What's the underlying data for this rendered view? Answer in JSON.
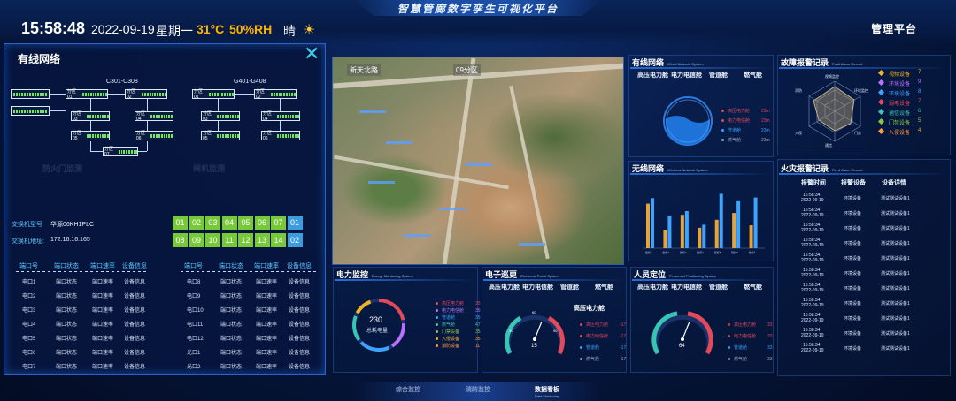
{
  "header": {
    "system_title": "智慧管廊数字孪生可视化平台",
    "time": "15:58:48",
    "date": "2022-09-19",
    "weekday": "星期一",
    "temperature": "31°C",
    "humidity": "50%RH",
    "weather": "晴",
    "weather_icon": "sun-icon",
    "management_label": "管理平台"
  },
  "overlay": {
    "title": "有线网络",
    "close_icon": "close-icon",
    "group_left": "C301-C308",
    "group_right": "G401-G408",
    "switches_left": [
      "分区01",
      "分区02",
      "分区03",
      "分区04",
      "分区05",
      "分区06",
      "分区07"
    ],
    "switches_right": [
      "分区01",
      "分区02",
      "分区03",
      "分区04",
      "分区05",
      "分区06"
    ],
    "switch_model_label": "交换机型号",
    "switch_model_value": "华源06KH1PLC",
    "switch_addr_label": "交换机地址:",
    "switch_addr_value": "172.16.16.165",
    "ports": [
      "01",
      "02",
      "03",
      "04",
      "05",
      "06",
      "07",
      "01",
      "08",
      "09",
      "10",
      "11",
      "12",
      "13",
      "14",
      "02"
    ],
    "port_colors": {
      "online": "#78c93a",
      "uplink": "#3b9de0"
    },
    "table_headers": [
      "端口号",
      "端口状态",
      "端口速率",
      "设备信息"
    ],
    "left_rows": [
      [
        "电口1",
        "端口状态",
        "端口速率",
        "设备信息"
      ],
      [
        "电口2",
        "端口状态",
        "端口速率",
        "设备信息"
      ],
      [
        "电口3",
        "端口状态",
        "端口速率",
        "设备信息"
      ],
      [
        "电口4",
        "端口状态",
        "端口速率",
        "设备信息"
      ],
      [
        "电口5",
        "端口状态",
        "端口速率",
        "设备信息"
      ],
      [
        "电口6",
        "端口状态",
        "端口速率",
        "设备信息"
      ],
      [
        "电口7",
        "端口状态",
        "端口速率",
        "设备信息"
      ]
    ],
    "right_rows": [
      [
        "电口8",
        "端口状态",
        "端口速率",
        "设备信息"
      ],
      [
        "电口9",
        "端口状态",
        "端口速率",
        "设备信息"
      ],
      [
        "电口10",
        "端口状态",
        "端口速率",
        "设备信息"
      ],
      [
        "电口11",
        "端口状态",
        "端口速率",
        "设备信息"
      ],
      [
        "电口12",
        "端口状态",
        "端口速率",
        "设备信息"
      ],
      [
        "光口1",
        "端口状态",
        "端口速率",
        "设备信息"
      ],
      [
        "光口2",
        "端口状态",
        "端口速率",
        "设备信息"
      ]
    ],
    "ghost_labels": [
      "防火门监测",
      "闸机监测"
    ]
  },
  "map": {
    "road_label": "新天北路",
    "area_label": "09分区"
  },
  "wired": {
    "title": "有线网络",
    "subtitle": "Wired Network System",
    "columns": [
      "高压电力舱",
      "电力电信舱",
      "管道舱",
      "燃气舱"
    ],
    "legend": [
      {
        "name": "高压电力舱",
        "value": "23m",
        "color": "#e2495b"
      },
      {
        "name": "电力电信舱",
        "value": "23m",
        "color": "#e2495b"
      },
      {
        "name": "管道舱",
        "value": "23m",
        "color": "#3ea3ff"
      },
      {
        "name": "燃气舱",
        "value": "23m",
        "color": "#9aa4b8"
      }
    ]
  },
  "wireless": {
    "title": "无线网络",
    "subtitle": "Wireless Network System",
    "chart_data": {
      "type": "bar",
      "categories": [
        "指标1",
        "指标2",
        "指标3",
        "指标4",
        "指标5",
        "指标6",
        "指标7"
      ],
      "series": [
        {
          "values": [
            72,
            30,
            54,
            33,
            46,
            57,
            37
          ],
          "color": "#e7a23a"
        },
        {
          "values": [
            81,
            53,
            60,
            38,
            88,
            76,
            82
          ],
          "color": "#3ea3ff"
        }
      ],
      "ylim": [
        0,
        100
      ]
    }
  },
  "fault": {
    "title": "故障报警记录",
    "subtitle": "Fault Alarm Record",
    "radar_labels": [
      "视频监控",
      "环境监控",
      "门禁",
      "通信",
      "入侵",
      "消防"
    ],
    "legend": [
      {
        "name": "视频设备",
        "value": "7",
        "color": "#f0b429"
      },
      {
        "name": "环境设备",
        "value": "9",
        "color": "#b672ff"
      },
      {
        "name": "环境设备",
        "value": "8",
        "color": "#3ea3ff"
      },
      {
        "name": "弱电设备",
        "value": "7",
        "color": "#e2495b"
      },
      {
        "name": "通信设备",
        "value": "6",
        "color": "#37c6b5"
      },
      {
        "name": "门禁设备",
        "value": "5",
        "color": "#8bc34a"
      },
      {
        "name": "入侵设备",
        "value": "4",
        "color": "#ff9a3c"
      }
    ]
  },
  "fire": {
    "title": "火灾报警记录",
    "subtitle": "Fired Alarm Record",
    "headers": [
      "报警时间",
      "报警设备",
      "设备详情"
    ],
    "rows": [
      [
        "15:58:34",
        "2022-09-19",
        "环境设备",
        "测试测试设备1"
      ],
      [
        "15:58:34",
        "2022-09-19",
        "环境设备",
        "测试测试设备1"
      ],
      [
        "15:58:34",
        "2022-09-19",
        "环境设备",
        "测试测试设备1"
      ],
      [
        "15:58:34",
        "2022-09-19",
        "环境设备",
        "测试测试设备1"
      ],
      [
        "15:58:34",
        "2022-09-19",
        "环境设备",
        "测试测试设备1"
      ],
      [
        "15:58:34",
        "2022-09-19",
        "环境设备",
        "测试测试设备1"
      ],
      [
        "15:58:34",
        "2022-09-19",
        "环境设备",
        "测试测试设备1"
      ],
      [
        "15:58:34",
        "2022-09-19",
        "环境设备",
        "测试测试设备1"
      ],
      [
        "15:58:34",
        "2022-09-19",
        "环境设备",
        "测试测试设备1"
      ],
      [
        "15:58:34",
        "2022-09-19",
        "环境设备",
        "测试测试设备1"
      ],
      [
        "15:58:34",
        "2022-09-19",
        "环境设备",
        "测试测试设备1"
      ]
    ]
  },
  "power": {
    "title": "电力监控",
    "subtitle": "Energy Monitoring System",
    "total_value": "230",
    "total_label": "总耗电量",
    "legend": [
      {
        "name": "高压电力舱",
        "value": "35",
        "color": "#e2495b"
      },
      {
        "name": "电力电信舱",
        "value": "35",
        "color": "#b672ff"
      },
      {
        "name": "管道舱",
        "value": "35",
        "color": "#3ea3ff"
      },
      {
        "name": "燃气舱",
        "value": "47",
        "color": "#37c6b5"
      },
      {
        "name": "门禁设备",
        "value": "35",
        "color": "#8bc34a"
      },
      {
        "name": "入侵设备",
        "value": "35",
        "color": "#f0b429"
      },
      {
        "name": "消防设备",
        "value": "11",
        "color": "#ff9a3c"
      }
    ]
  },
  "fence": {
    "title": "电子巡更",
    "subtitle": "Electronic Patrol System",
    "columns": [
      "高压电力舱",
      "电力电信舱",
      "管道舱",
      "燃气舱"
    ],
    "gauge_title": "高压电力舱",
    "gauge_value": "15",
    "gauge_ticks": [
      "0",
      "30",
      "60",
      "90",
      "120"
    ],
    "legend": [
      {
        "name": "高压电力舱",
        "value": "-17",
        "color": "#e2495b"
      },
      {
        "name": "电力电信舱",
        "value": "-17",
        "color": "#e2495b"
      },
      {
        "name": "管道舱",
        "value": "-17",
        "color": "#3ea3ff"
      },
      {
        "name": "燃气舱",
        "value": "-17",
        "color": "#9aa4b8"
      }
    ]
  },
  "person": {
    "title": "人员定位",
    "subtitle": "Personnel Positioning System",
    "columns": [
      "高压电力舱",
      "电力电信舱",
      "管道舱",
      "燃气舱"
    ],
    "gauge_value": "64",
    "legend": [
      {
        "name": "高压电力舱",
        "value": "33",
        "color": "#e2495b"
      },
      {
        "name": "电力电信舱",
        "value": "33",
        "color": "#e2495b"
      },
      {
        "name": "管道舱",
        "value": "33",
        "color": "#3ea3ff"
      },
      {
        "name": "燃气舱",
        "value": "33",
        "color": "#9aa4b8"
      }
    ]
  },
  "nav": {
    "items": [
      "综合监控",
      "消防监控",
      "数据看板"
    ],
    "active_sub": "Data Monitoring"
  }
}
